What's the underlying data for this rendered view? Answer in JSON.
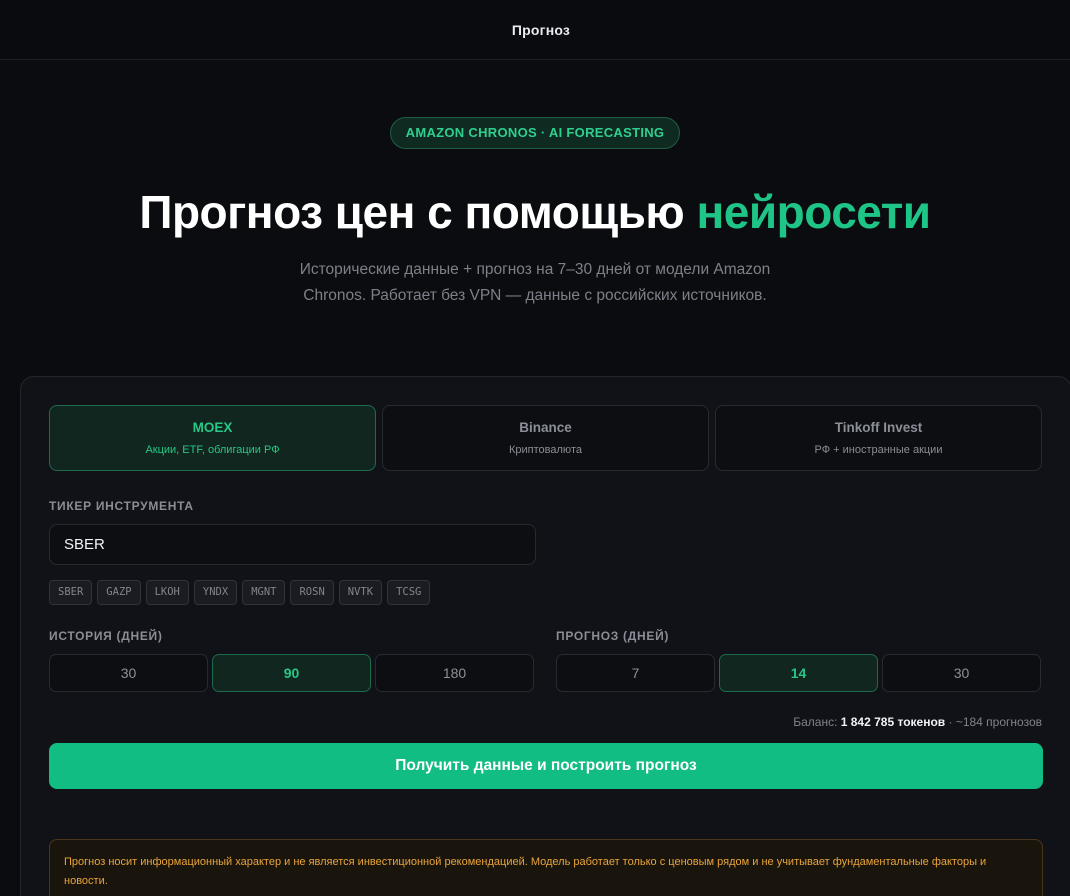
{
  "header": {
    "title": "Прогноз"
  },
  "hero": {
    "badge": "AMAZON CHRONOS · AI FORECASTING",
    "headline_main": "Прогноз цен с помощью ",
    "headline_accent": "нейросети",
    "subtitle": "Исторические данные + прогноз на 7–30 дней от модели Amazon Chronos. Работает без VPN — данные с российских источников."
  },
  "sources": [
    {
      "name": "MOEX",
      "desc": "Акции, ETF, облигации РФ",
      "active": true
    },
    {
      "name": "Binance",
      "desc": "Криптовалюта",
      "active": false
    },
    {
      "name": "Tinkoff Invest",
      "desc": "РФ + иностранные акции",
      "active": false
    }
  ],
  "ticker": {
    "label": "ТИКЕР ИНСТРУМЕНТА",
    "value": "SBER",
    "chips": [
      "SBER",
      "GAZP",
      "LKOH",
      "YNDX",
      "MGNT",
      "ROSN",
      "NVTK",
      "TCSG"
    ]
  },
  "history": {
    "label": "ИСТОРИЯ (ДНЕЙ)",
    "options": [
      "30",
      "90",
      "180"
    ],
    "selected": "90"
  },
  "forecast": {
    "label": "ПРОГНОЗ (ДНЕЙ)",
    "options": [
      "7",
      "14",
      "30"
    ],
    "selected": "14"
  },
  "balance": {
    "prefix": "Баланс: ",
    "tokens": "1 842 785 токенов",
    "suffix": " · ~184 прогнозов"
  },
  "cta": {
    "label": "Получить данные и построить прогноз"
  },
  "notice": {
    "text": "Прогноз носит информационный характер и не является инвестиционной рекомендацией. Модель работает только с ценовым рядом и не учитывает фундаментальные факторы и новости."
  },
  "colors": {
    "accent": "#12bd83",
    "background": "#0b0c10",
    "warning": "#e8a43c"
  }
}
